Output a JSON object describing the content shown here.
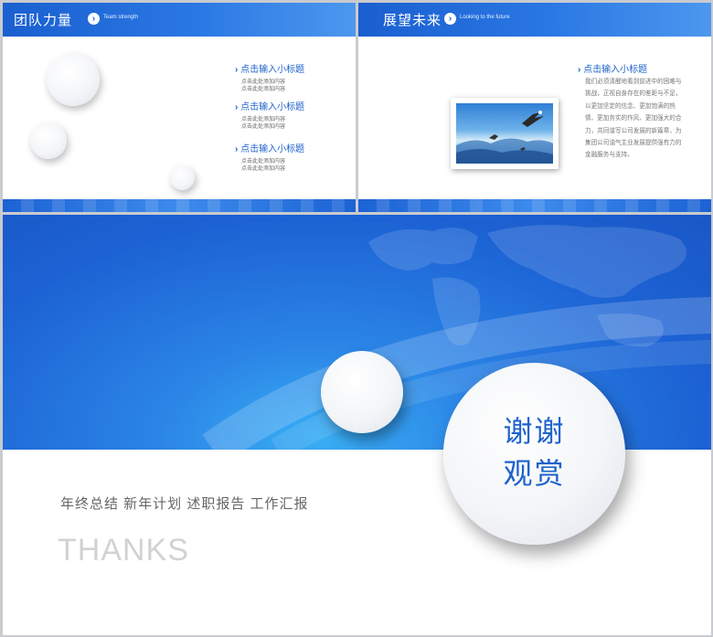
{
  "slide1": {
    "title": "团队力量",
    "subtitle": "Team strength",
    "items": [
      {
        "title": "点击输入小标题",
        "line1": "点击此处添加内容",
        "line2": "点击此处添加内容"
      },
      {
        "title": "点击输入小标题",
        "line1": "点击此处添加内容",
        "line2": "点击此处添加内容"
      },
      {
        "title": "点击输入小标题",
        "line1": "点击此处添加内容",
        "line2": "点击此处添加内容"
      }
    ]
  },
  "slide2": {
    "title": "展望未来",
    "subtitle": "Looking to the future",
    "item_title": "点击输入小标题",
    "paragraph": "我们必须清醒地看到前进中的困难与挑战，正视自身存在的差距与不足，以更加坚定的信念、更加饱满的热情、更加务实的作风、更加强大的合力，共同谱写公司发展的新篇章，为集团公司油气主业发展提供强有力的金融服务与支持。"
  },
  "slide3": {
    "circle_line1": "谢谢",
    "circle_line2": "观赏",
    "tagline": "年终总结  新年计划  述职报告  工作汇报",
    "thanks": "THANKS"
  },
  "colors": {
    "brand_blue": "#1d62cc",
    "header_blue": "#2a78e4",
    "background_gray": "#c9cbd0"
  },
  "icons": {
    "arrow": "chevron-right-icon",
    "bird": "eagle-icon"
  }
}
